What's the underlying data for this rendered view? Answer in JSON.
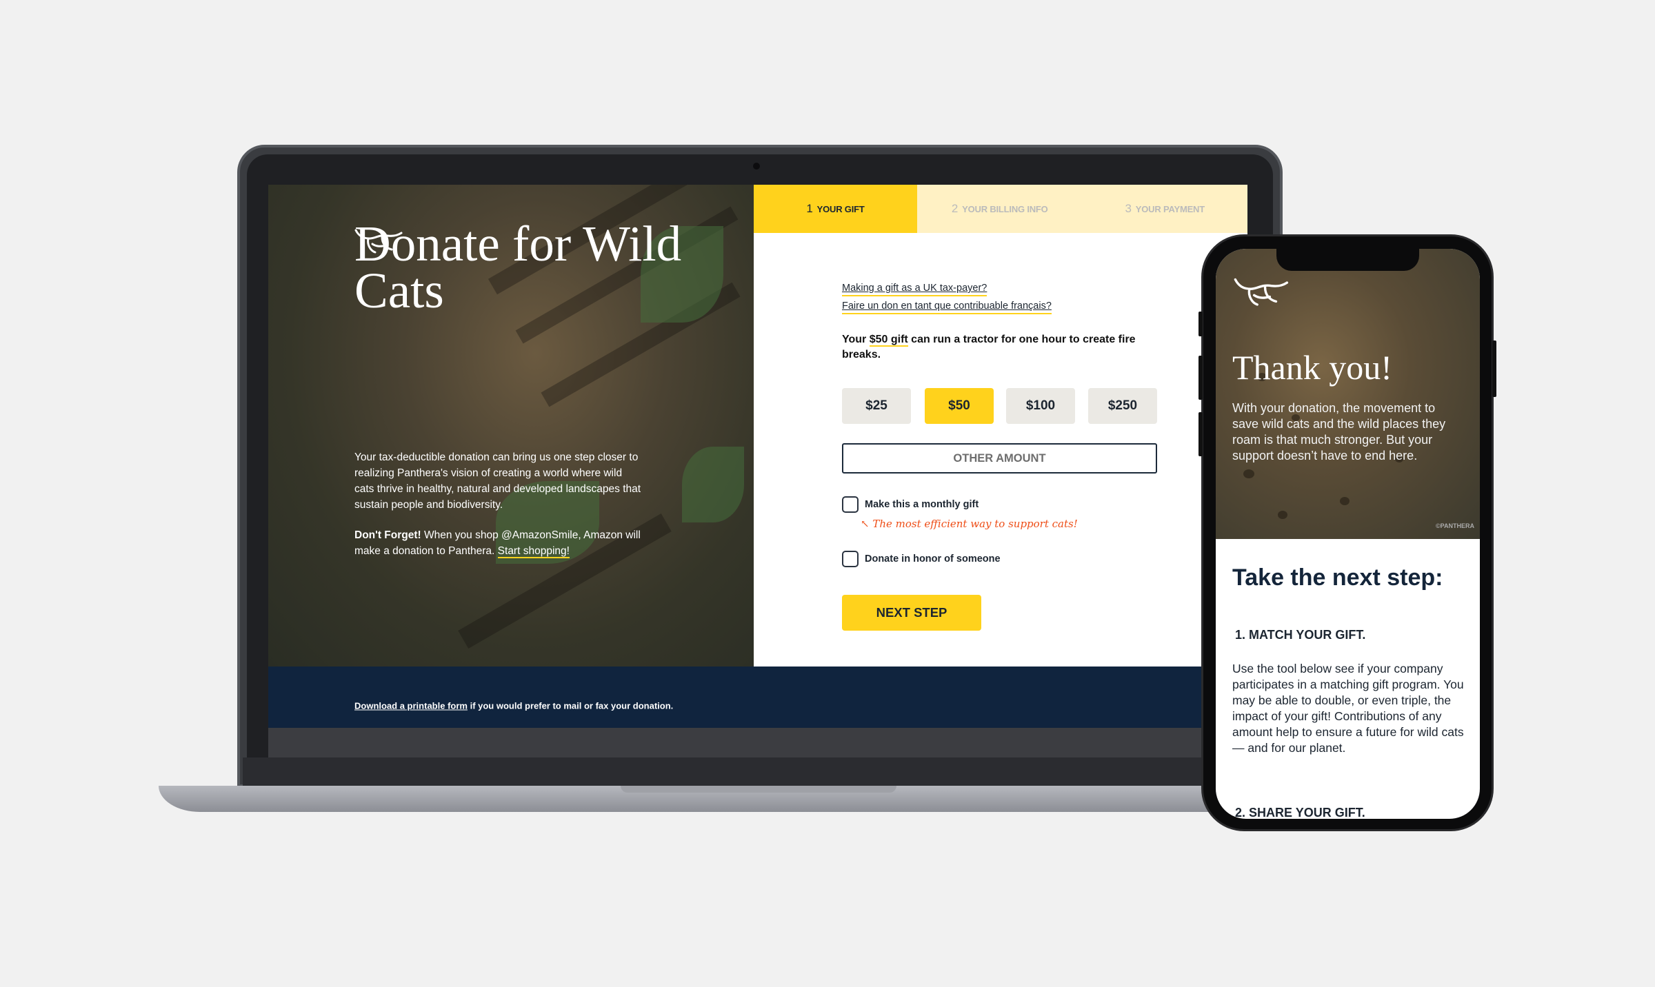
{
  "colors": {
    "accent": "#ffd21c",
    "navy": "#10243e",
    "handwriting": "#ee4d16",
    "background": "#f1f1f1"
  },
  "laptop": {
    "hero": {
      "logo": "panthera-cat-logo",
      "title": "Donate for Wild Cats",
      "intro": "Your tax-deductible donation can bring us one step closer to realizing Panthera's vision of creating a world where wild cats thrive in healthy, natural and developed landscapes that sustain people and biodiversity.",
      "dont_forget_bold": "Don't Forget!",
      "dont_forget": " When you shop @AmazonSmile, Amazon will make a donation to Panthera.  ",
      "start_shopping": "Start shopping!"
    },
    "steps": [
      {
        "num": "1",
        "label": "YOUR GIFT",
        "active": true
      },
      {
        "num": "2",
        "label": "YOUR BILLING INFO"
      },
      {
        "num": "3",
        "label": "YOUR PAYMENT"
      }
    ],
    "form": {
      "uk_link": "Making a gift as a UK tax-payer?",
      "fr_link": "Faire un don en tant que contribuable français?",
      "pitch_pre": "Your ",
      "pitch_amount": "$50 gift",
      "pitch_post": " can run a tractor for one hour to create fire breaks.",
      "amounts": [
        "$25",
        "$50",
        "$100",
        "$250"
      ],
      "selected_amount": "$50",
      "other_amount": "OTHER AMOUNT",
      "monthly_label": "Make this a monthly gift",
      "monthly_checked": false,
      "monthly_note": "↖ The most efficient way to support cats!",
      "honor_label": "Donate in honor of someone",
      "honor_checked": false,
      "next_label": "NEXT STEP"
    },
    "footer": {
      "link": "Download a printable form",
      "text": " if you would prefer to mail or fax your donation."
    }
  },
  "phone": {
    "logo": "panthera-cat-logo",
    "title": "Thank you!",
    "para": "With your donation, the movement to save wild cats and the wild places they roam is that much stronger. But your support doesn’t have to end here.",
    "watermark": "©PANTHERA",
    "next_heading": "Take the next step:",
    "step1": "1. MATCH YOUR GIFT.",
    "step1_text": "Use the tool below see if your company participates in a matching gift program. You may be able to double, or even triple, the impact of your gift! Contributions of any amount help to ensure a future for wild cats — and for our planet.",
    "step2": "2. SHARE YOUR GIFT."
  }
}
